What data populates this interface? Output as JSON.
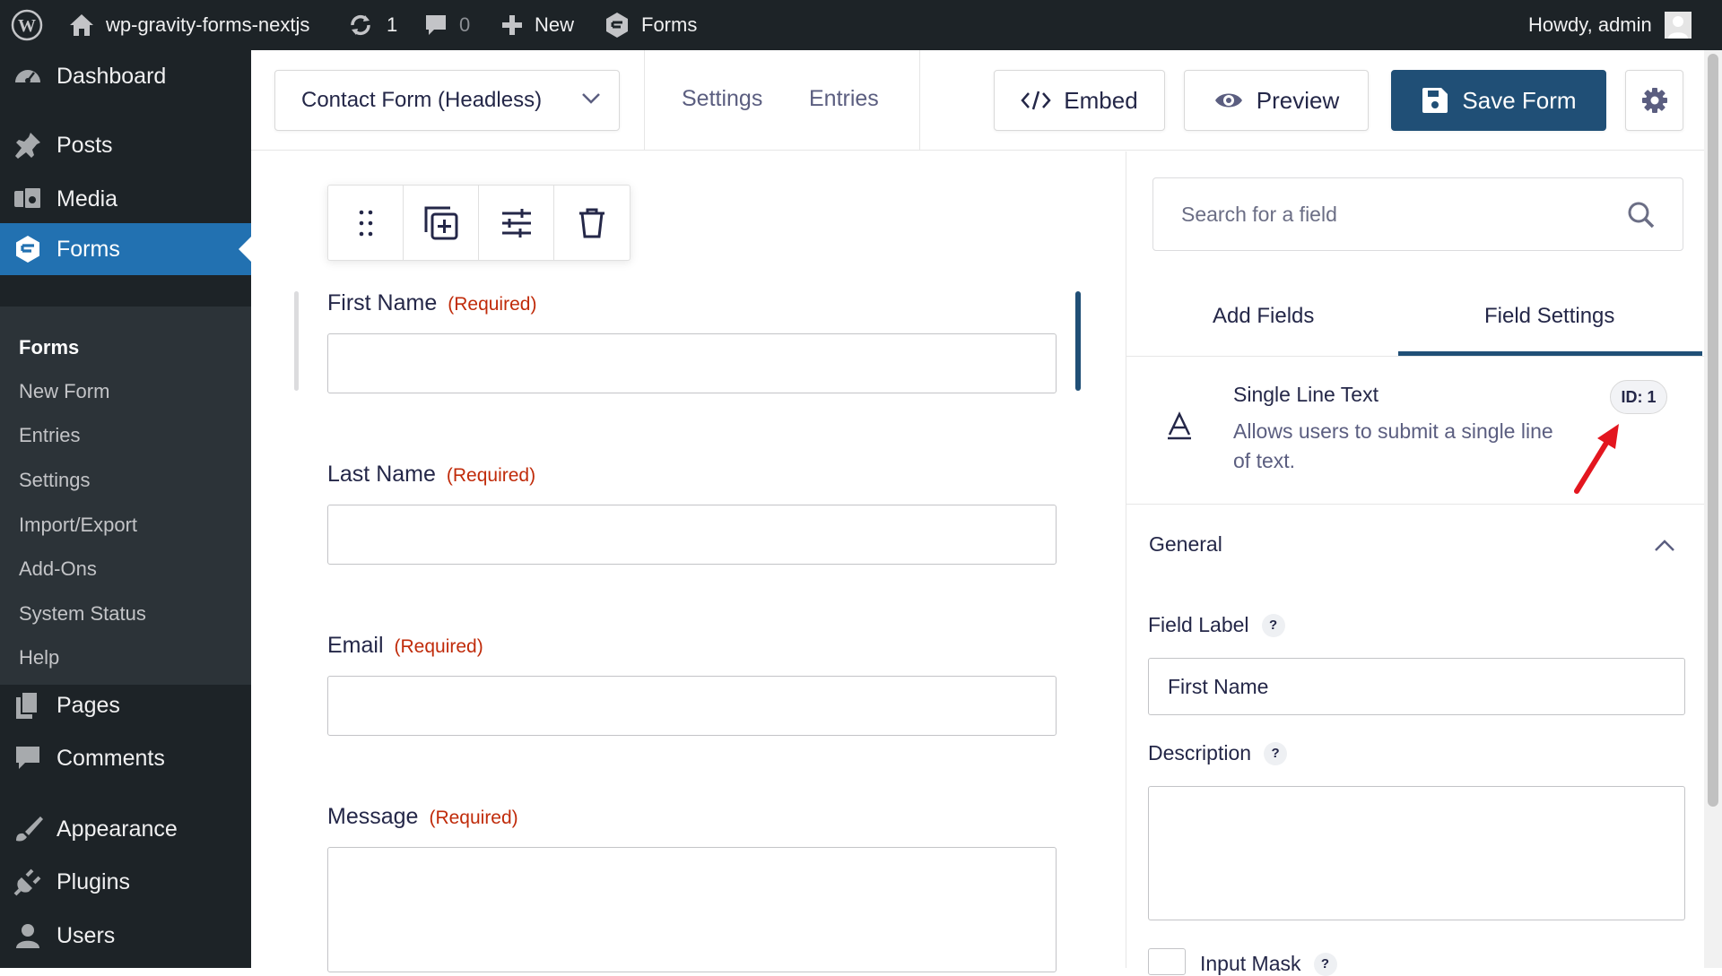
{
  "admin_bar": {
    "site_name": "wp-gravity-forms-nextjs",
    "updates_count": "1",
    "comments_count": "0",
    "new_label": "New",
    "forms_label": "Forms",
    "greeting": "Howdy, admin"
  },
  "sidebar": {
    "items": [
      {
        "label": "Dashboard",
        "icon": "dashboard-icon"
      },
      {
        "label": "Posts",
        "icon": "pushpin-icon"
      },
      {
        "label": "Media",
        "icon": "media-icon"
      },
      {
        "label": "Forms",
        "icon": "gravity-forms-icon"
      },
      {
        "label": "Pages",
        "icon": "pages-icon"
      },
      {
        "label": "Comments",
        "icon": "comment-bubble-icon"
      },
      {
        "label": "Appearance",
        "icon": "paintbrush-icon"
      },
      {
        "label": "Plugins",
        "icon": "plug-icon"
      },
      {
        "label": "Users",
        "icon": "user-icon"
      }
    ],
    "submenu": [
      "Forms",
      "New Form",
      "Entries",
      "Settings",
      "Import/Export",
      "Add-Ons",
      "System Status",
      "Help"
    ]
  },
  "toolbar": {
    "form_name": "Contact Form (Headless)",
    "settings_link": "Settings",
    "entries_link": "Entries",
    "embed_label": "Embed",
    "preview_label": "Preview",
    "save_label": "Save Form"
  },
  "form_fields": [
    {
      "label": "First Name",
      "required": "(Required)"
    },
    {
      "label": "Last Name",
      "required": "(Required)"
    },
    {
      "label": "Email",
      "required": "(Required)"
    },
    {
      "label": "Message",
      "required": "(Required)"
    }
  ],
  "panel": {
    "search_placeholder": "Search for a field",
    "tab_add": "Add Fields",
    "tab_settings": "Field Settings",
    "field_type_title": "Single Line Text",
    "field_type_desc": "Allows users to submit a single line of text.",
    "field_id": "ID: 1",
    "section_title": "General",
    "field_label_label": "Field Label",
    "field_label_value": "First Name",
    "description_label": "Description",
    "description_value": "",
    "input_mask_label": "Input Mask",
    "help_mark": "?"
  },
  "colors": {
    "admin_dark": "#1d2327",
    "submenu_bg": "#2c3338",
    "wp_blue": "#2271b1",
    "gf_primary": "#204f76",
    "required_red": "#c02b0a",
    "annotation_arrow": "#e3161f"
  }
}
